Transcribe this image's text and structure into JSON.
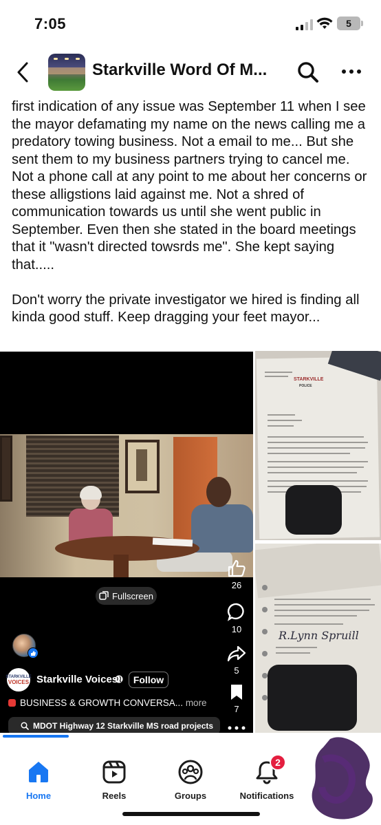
{
  "status_bar": {
    "time": "7:05",
    "battery": "5",
    "signal_bars_active": 2,
    "signal_bars_total": 4
  },
  "header": {
    "back_icon": "chevron-left-icon",
    "group_name": "Starkville Word Of M...",
    "search_icon": "search-icon",
    "more_icon": "more-horizontal-icon"
  },
  "post": {
    "paragraph_1": "first indication of any issue was September 11 when I see the mayor defamating my name on the news calling me a predatory towing business. Not a email to me... But she sent them to my business partners trying to cancel me. Not a phone call at any point to me about her concerns or these alligstions laid against me. Not a shred of communication towards us until she went public in September. Even then she stated in the board meetings that it \"wasn't directed towsrds me\". She kept saying that.....",
    "paragraph_2": "Don't worry the private investigator we hired is finding all kinda good stuff. Keep dragging your feet mayor..."
  },
  "video": {
    "fullscreen_label": "Fullscreen",
    "likes": "26",
    "comments": "10",
    "shares": "5",
    "saves": "7",
    "page_name": "Starkville Voices",
    "follow_label": "Follow",
    "caption": "BUSINESS & GROWTH CONVERSA...",
    "caption_more": "more",
    "search_chip": "MDOT Highway 12 Starkville MS road projects",
    "logo_line1": "STARKVILLE",
    "logo_line2": "VOICES"
  },
  "documents": {
    "doc1_logo": "STARKVILLE",
    "doc1_logo_sub": "POLICE",
    "doc2_signature": "R.Lynn Spruill"
  },
  "tabbar": {
    "tabs": [
      {
        "label": "Home",
        "icon": "home-icon",
        "active": true
      },
      {
        "label": "Reels",
        "icon": "reels-icon",
        "active": false
      },
      {
        "label": "Groups",
        "icon": "groups-icon",
        "active": false
      },
      {
        "label": "Notifications",
        "icon": "bell-icon",
        "active": false,
        "badge": "2"
      }
    ]
  },
  "colors": {
    "accent": "#1877f2",
    "badge": "#e41e3f",
    "video_bg": "#000000"
  }
}
